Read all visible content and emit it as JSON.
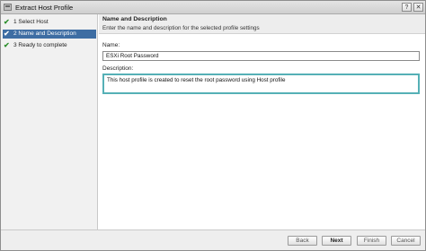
{
  "window": {
    "title": "Extract Host Profile",
    "help_glyph": "?",
    "close_glyph": "✕"
  },
  "steps": [
    {
      "check": "✔",
      "label": "1  Select Host",
      "state": "done"
    },
    {
      "check": "✔",
      "label": "2  Name and Description",
      "state": "active"
    },
    {
      "check": "✔",
      "label": "3  Ready to complete",
      "state": "done"
    }
  ],
  "section": {
    "title": "Name and Description",
    "subtitle": "Enter the name and description for the selected profile settings"
  },
  "form": {
    "name_label": "Name:",
    "name_value": "ESXi Root Password",
    "description_label": "Description:",
    "description_value": "This host profile is created to reset the root password using Host profile"
  },
  "buttons": {
    "back": "Back",
    "next": "Next",
    "finish": "Finish",
    "cancel": "Cancel"
  },
  "colors": {
    "active_step": "#3e6da3",
    "check": "#2d8f2d",
    "focus_border": "#55b0b6"
  },
  "icons": {
    "title": "host-profile-icon",
    "step_status": "checkmark-icon"
  }
}
